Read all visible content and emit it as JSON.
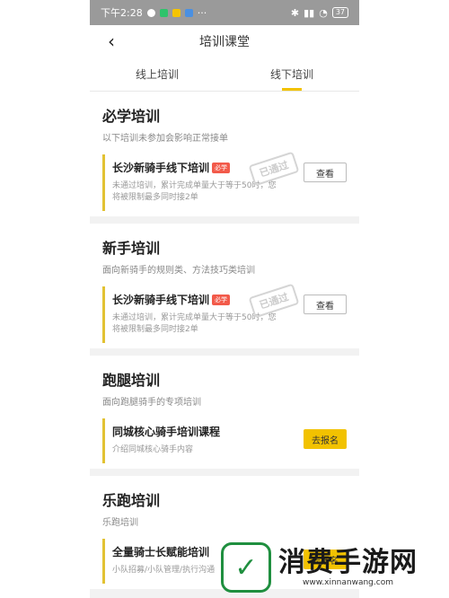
{
  "status_bar": {
    "time": "下午2:28",
    "battery": "37"
  },
  "navbar": {
    "title": "培训课堂"
  },
  "tabs": [
    {
      "label": "线上培训"
    },
    {
      "label": "线下培训"
    }
  ],
  "sections": [
    {
      "title": "必学培训",
      "subtitle": "以下培训未参加会影响正常接单",
      "card": {
        "title": "长沙新骑手线下培训",
        "badge": "必学",
        "desc": "未通过培训，累计完成单量大于等于50时，您将被限制最多同时接2单",
        "stamp": "已通过",
        "action": "查看"
      }
    },
    {
      "title": "新手培训",
      "subtitle": "面向新骑手的规则类、方法技巧类培训",
      "card": {
        "title": "长沙新骑手线下培训",
        "badge": "必学",
        "desc": "未通过培训，累计完成单量大于等于50时，您将被限制最多同时接2单",
        "stamp": "已通过",
        "action": "查看"
      }
    },
    {
      "title": "跑腿培训",
      "subtitle": "面向跑腿骑手的专项培训",
      "card": {
        "title": "同城核心骑手培训课程",
        "desc": "介绍同城核心骑手内容",
        "action": "去报名"
      }
    },
    {
      "title": "乐跑培训",
      "subtitle": "乐跑培训",
      "card": {
        "title": "全量骑士长赋能培训",
        "desc": "小队招募/小队管理/执行沟通",
        "action": "去报名"
      }
    }
  ],
  "watermark": {
    "logo_glyph": "✓",
    "text": "消费手游网",
    "url": "www.xinnanwang.com"
  },
  "colors": {
    "accent": "#f2c200",
    "badge": "#f25a4a",
    "status_bar": "#9a9a9a"
  }
}
